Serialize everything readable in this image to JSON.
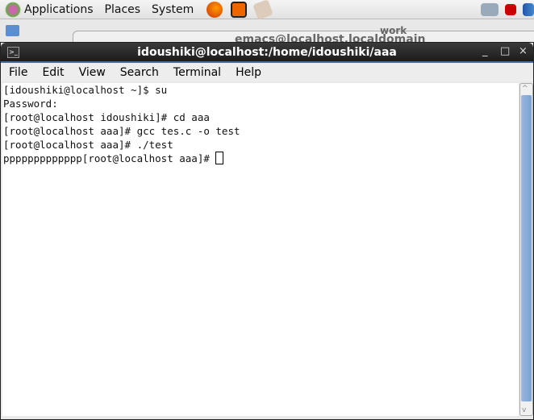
{
  "panel": {
    "menus": [
      "Applications",
      "Places",
      "System"
    ],
    "launchers": [
      "firefox-icon",
      "app-icon",
      "mail-icon"
    ],
    "tray": [
      "network-icon",
      "volume-muted-icon",
      "signal-icon"
    ]
  },
  "background_window": {
    "title": "emacs@localhost.localdomain",
    "label": "work"
  },
  "terminal": {
    "title": "idoushiki@localhost:/home/idoushiki/aaa",
    "menu": [
      "File",
      "Edit",
      "View",
      "Search",
      "Terminal",
      "Help"
    ],
    "lines": [
      "[idoushiki@localhost ~]$ su",
      "Password:",
      "[root@localhost idoushiki]# cd aaa",
      "[root@localhost aaa]# gcc tes.c -o test",
      "[root@localhost aaa]# ./test",
      "ppppppppppppp[root@localhost aaa]# "
    ]
  }
}
